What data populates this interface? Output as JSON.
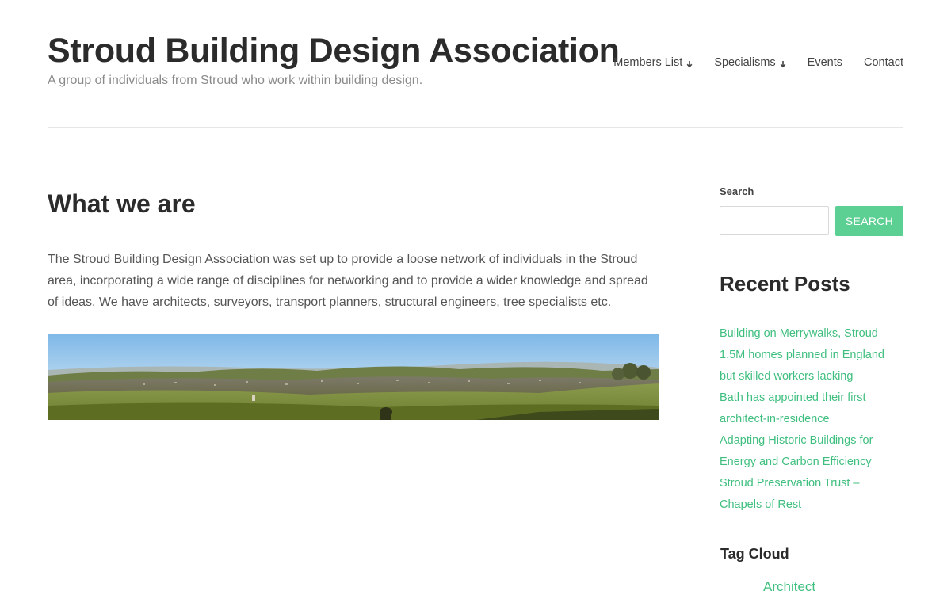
{
  "header": {
    "title": "Stroud Building Design Association",
    "tagline": "A group of individuals from Stroud who work within building design."
  },
  "nav": {
    "items": [
      {
        "label": "Members List",
        "has_dropdown": true
      },
      {
        "label": "Specialisms",
        "has_dropdown": true
      },
      {
        "label": "Events",
        "has_dropdown": false
      },
      {
        "label": "Contact",
        "has_dropdown": false
      }
    ]
  },
  "main": {
    "heading": "What we are",
    "paragraph": "The Stroud Building Design Association was set up to provide a loose network of individuals in the Stroud area, incorporating a wide range of disciplines for networking and to provide a wider knowledge and spread of ideas. We have architects, surveyors, transport planners, structural engineers, tree specialists etc."
  },
  "sidebar": {
    "search": {
      "label": "Search",
      "input_value": "",
      "button_label": "SEARCH"
    },
    "recent_posts": {
      "title": "Recent Posts",
      "items": [
        "Building on Merrywalks, Stroud",
        "1.5M homes planned in England but skilled workers lacking",
        "Bath has appointed their first architect-in-residence",
        "Adapting Historic Buildings for Energy and Carbon Efficiency",
        "Stroud Preservation Trust – Chapels of Rest"
      ]
    },
    "tag_cloud": {
      "title": "Tag Cloud",
      "first_tag": "Architect"
    }
  },
  "colors": {
    "accent": "#5ccf93",
    "link": "#3fbf7f",
    "heading": "#2b2b2b",
    "body_text": "#555555"
  }
}
